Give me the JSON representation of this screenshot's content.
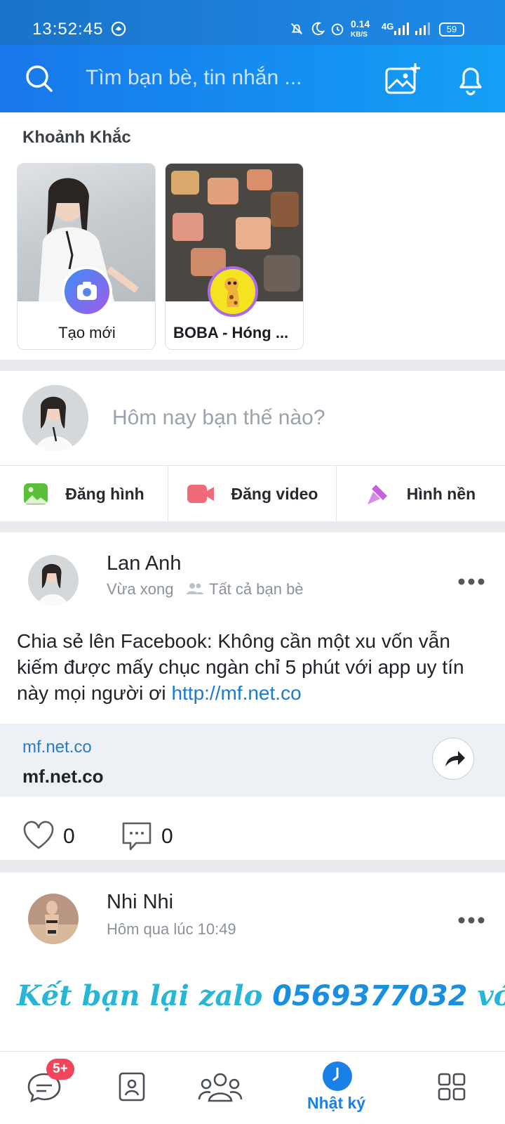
{
  "status_bar": {
    "time": "13:52:45",
    "net_speed_value": "0.14",
    "net_speed_unit": "KB/S",
    "network": "4G",
    "battery": "59"
  },
  "header": {
    "search_placeholder": "Tìm bạn bè, tin nhắn ...",
    "icons": [
      "search-icon",
      "add-photo-icon",
      "bell-icon"
    ]
  },
  "moments": {
    "title": "Khoảnh Khắc",
    "items": [
      {
        "label": "Tạo mới",
        "badge": "camera-icon"
      },
      {
        "label": "BOBA - Hóng ..."
      }
    ]
  },
  "composer": {
    "placeholder": "Hôm nay bạn thế nào?",
    "actions": [
      {
        "label": "Đăng hình",
        "icon": "photo-icon",
        "color": "#5cbf3a"
      },
      {
        "label": "Đăng video",
        "icon": "video-icon",
        "color": "#f06b7a"
      },
      {
        "label": "Hình nền",
        "icon": "brush-icon",
        "color": "#c561e0"
      }
    ]
  },
  "posts": [
    {
      "author": "Lan Anh",
      "time": "Vừa xong",
      "privacy": "Tất cả bạn bè",
      "text": "Chia sẻ lên Facebook: Không cần một xu vốn vẫn kiếm được mấy chục ngàn chỉ 5 phút với app uy tín này mọi người ơi ",
      "link": "http://mf.net.co",
      "preview_domain": "mf.net.co",
      "preview_title": "mf.net.co",
      "likes": "0",
      "comments": "0"
    },
    {
      "author": "Nhi Nhi",
      "time": "Hôm qua lúc 10:49",
      "styled_text_a": "Kết bạn lại zalo ",
      "styled_text_phone": "0569377032",
      "styled_text_b": " với em"
    }
  ],
  "bottom_nav": {
    "messages_badge": "5+",
    "active_label": "Nhật ký",
    "accent": "#1a7fe6"
  }
}
